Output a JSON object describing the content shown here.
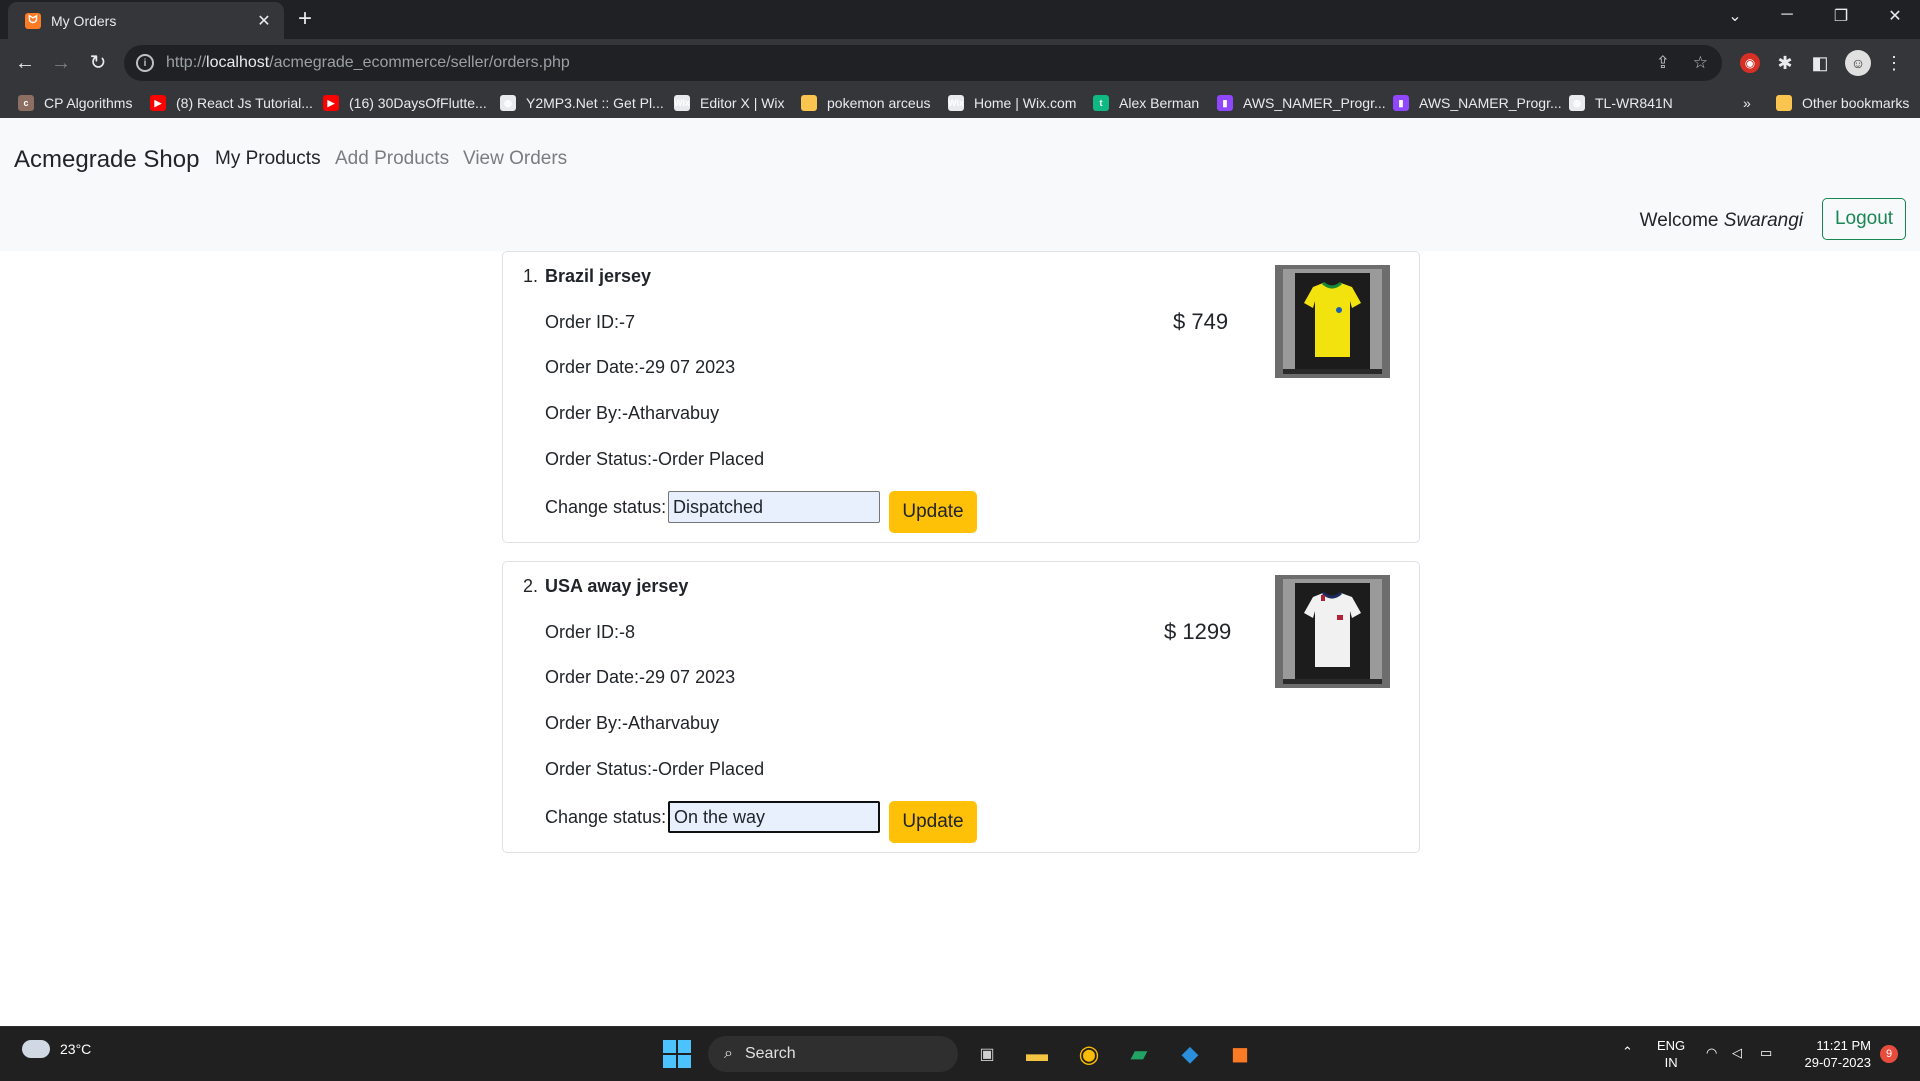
{
  "browser": {
    "tab_title": "My Orders",
    "tab_close": "✕",
    "new_tab": "+",
    "url_prefix": "http://",
    "url_host": "localhost",
    "url_path": "/acmegrade_ecommerce/seller/orders.php",
    "bookmarks": [
      {
        "label": "CP Algorithms",
        "icon": "cp-algorithms-icon"
      },
      {
        "label": "(8) React Js Tutorial...",
        "icon": "youtube-icon"
      },
      {
        "label": "(16) 30DaysOfFlutte...",
        "icon": "youtube-icon"
      },
      {
        "label": "Y2MP3.Net :: Get Pl...",
        "icon": "globe-icon"
      },
      {
        "label": "Editor X | Wix",
        "icon": "wix-icon"
      },
      {
        "label": "pokemon arceus",
        "icon": "folder-icon"
      },
      {
        "label": "Home | Wix.com",
        "icon": "wix-icon"
      },
      {
        "label": "Alex Berman",
        "icon": "alex-icon"
      },
      {
        "label": "AWS_NAMER_Progr...",
        "icon": "twitch-icon"
      },
      {
        "label": "AWS_NAMER_Progr...",
        "icon": "twitch-icon"
      },
      {
        "label": "TL-WR841N",
        "icon": "globe-icon"
      }
    ],
    "bookmarks_more": "»",
    "other_bookmarks": "Other bookmarks"
  },
  "navbar": {
    "brand": "Acmegrade Shop",
    "links": [
      "My Products",
      "Add Products",
      "View Orders"
    ],
    "welcome_prefix": "Welcome",
    "user": "Swarangi",
    "logout_label": "Logout"
  },
  "orders": [
    {
      "index": "1.",
      "product": "Brazil jersey",
      "order_id": "Order ID:-7",
      "order_date": "Order Date:-29 07 2023",
      "order_by": "Order By:-Atharvabuy",
      "order_status": "Order Status:-Order Placed",
      "price": "$ 749",
      "change_status_label": "Change status:",
      "status_value": "Dispatched",
      "update_label": "Update",
      "shirt_color": "#f2e20e"
    },
    {
      "index": "2.",
      "product": "USA away jersey",
      "order_id": "Order ID:-8",
      "order_date": "Order Date:-29 07 2023",
      "order_by": "Order By:-Atharvabuy",
      "order_status": "Order Status:-Order Placed",
      "price": "$ 1299",
      "change_status_label": "Change status:",
      "status_value": "On the way",
      "update_label": "Update",
      "shirt_color": "#f1f1f1"
    }
  ],
  "taskbar": {
    "temperature": "23°C",
    "search_label": "Search",
    "lang_top": "ENG",
    "lang_bottom": "IN",
    "time": "11:21 PM",
    "date": "29-07-2023",
    "notifications": "9"
  },
  "colors": {
    "accent_success": "#198754",
    "accent_warning": "#ffc107",
    "chrome_dark": "#35363a"
  }
}
